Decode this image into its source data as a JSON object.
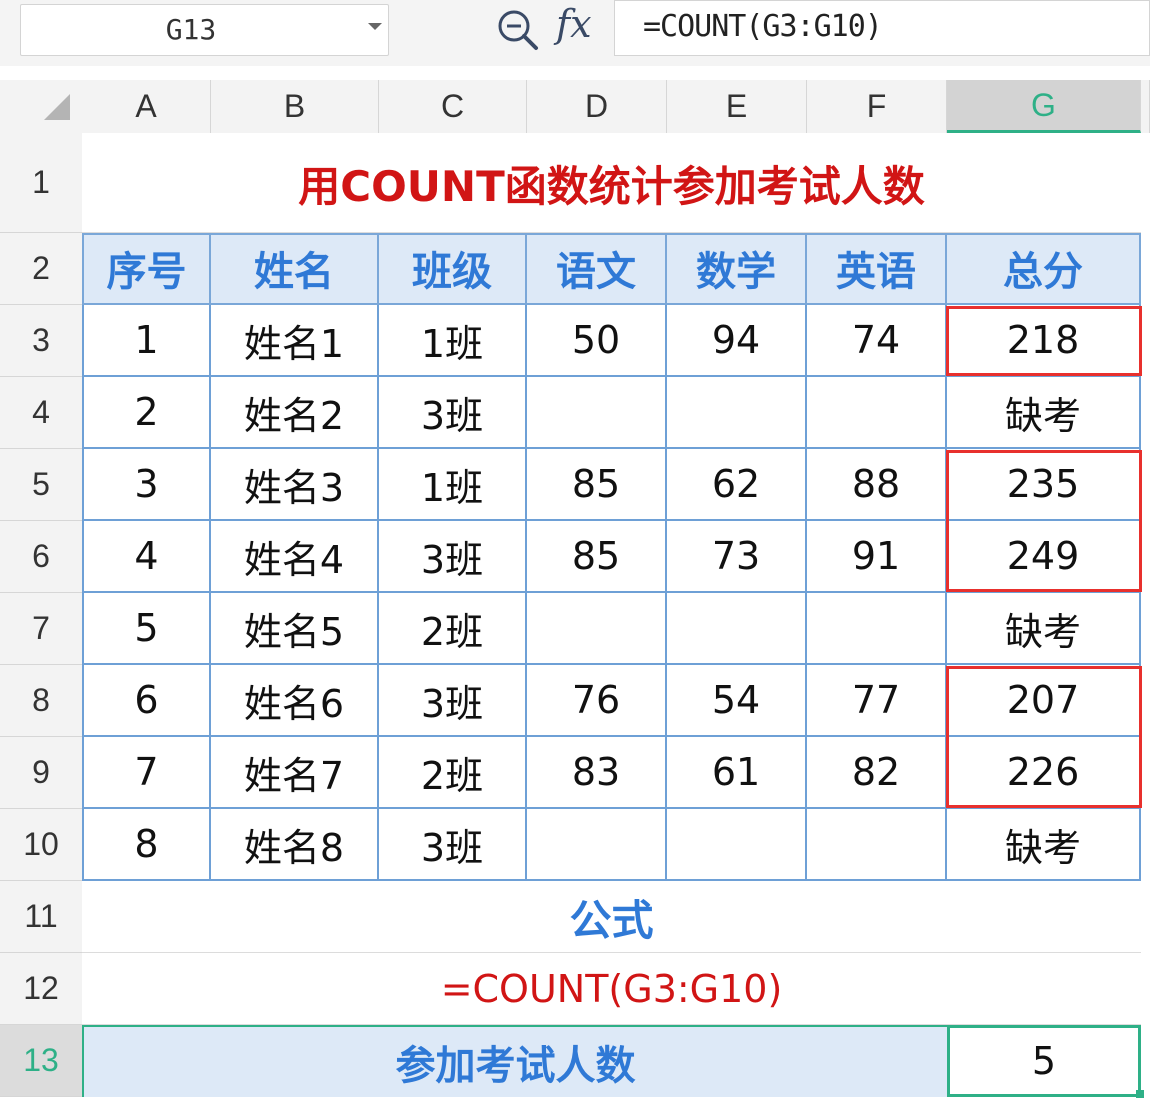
{
  "formula_bar": {
    "name_box": "G13",
    "fx_label": "fx",
    "formula": "=COUNT(G3:G10)"
  },
  "columns": [
    "A",
    "B",
    "C",
    "D",
    "E",
    "F",
    "G"
  ],
  "rows": [
    "1",
    "2",
    "3",
    "4",
    "5",
    "6",
    "7",
    "8",
    "9",
    "10",
    "11",
    "12",
    "13"
  ],
  "sheet": {
    "title": "用COUNT函数统计参加考试人数",
    "headers": [
      "序号",
      "姓名",
      "班级",
      "语文",
      "数学",
      "英语",
      "总分"
    ],
    "data": [
      [
        "1",
        "姓名1",
        "1班",
        "50",
        "94",
        "74",
        "218"
      ],
      [
        "2",
        "姓名2",
        "3班",
        "",
        "",
        "",
        "缺考"
      ],
      [
        "3",
        "姓名3",
        "1班",
        "85",
        "62",
        "88",
        "235"
      ],
      [
        "4",
        "姓名4",
        "3班",
        "85",
        "73",
        "91",
        "249"
      ],
      [
        "5",
        "姓名5",
        "2班",
        "",
        "",
        "",
        "缺考"
      ],
      [
        "6",
        "姓名6",
        "3班",
        "76",
        "54",
        "77",
        "207"
      ],
      [
        "7",
        "姓名7",
        "2班",
        "83",
        "61",
        "82",
        "226"
      ],
      [
        "8",
        "姓名8",
        "3班",
        "",
        "",
        "",
        "缺考"
      ]
    ],
    "formula_label": "公式",
    "formula_display": "=COUNT(G3:G10)",
    "result_label": "参加考试人数",
    "result_value": "5"
  },
  "colors": {
    "title": "#d11515",
    "header_bg": "#dde9f7",
    "header_text": "#2f79d6",
    "highlight": "#e8302d",
    "selection": "#2eb087"
  }
}
